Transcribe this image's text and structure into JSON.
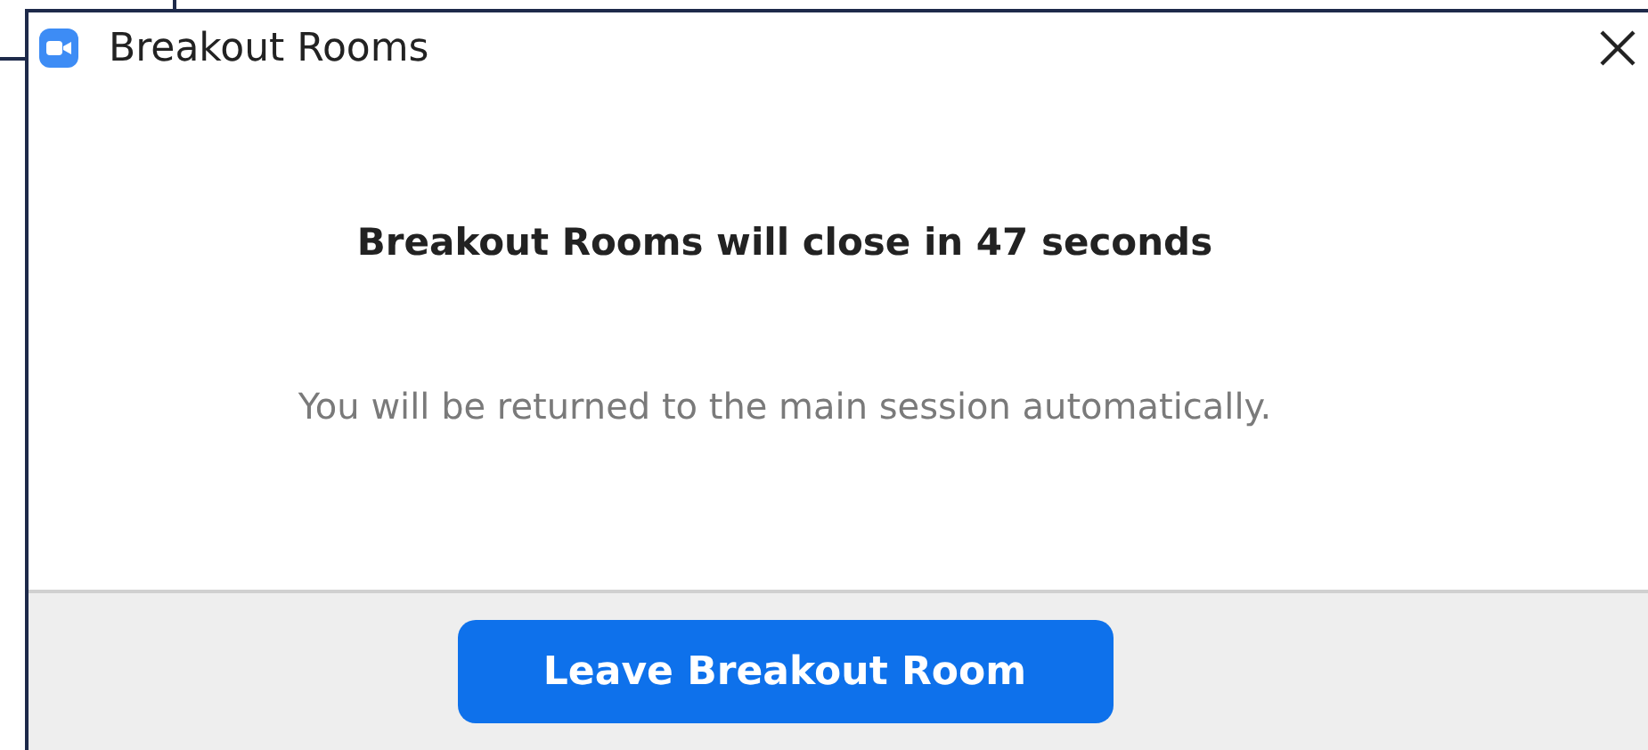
{
  "window": {
    "title": "Breakout Rooms"
  },
  "message": {
    "heading": "Breakout Rooms will close in 47 seconds",
    "detail": "You will be returned to the main session automatically."
  },
  "buttons": [
    {
      "label": "Leave Breakout Room",
      "kind": "primary"
    }
  ]
}
